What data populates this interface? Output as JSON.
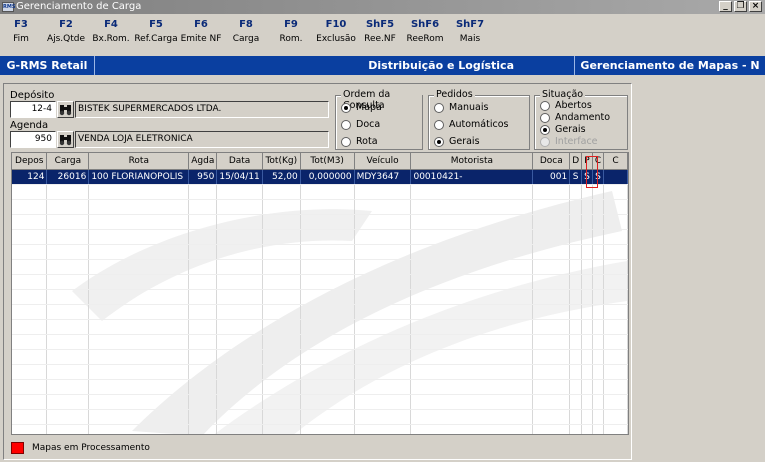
{
  "window": {
    "title": "Gerenciamento de Carga",
    "icon_text": "RMS",
    "buttons": [
      "_",
      "❐",
      "×"
    ]
  },
  "function_keys": [
    {
      "key": "F3",
      "label": "Fim"
    },
    {
      "key": "F2",
      "label": "Ajs.Qtde"
    },
    {
      "key": "F4",
      "label": "Bx.Rom."
    },
    {
      "key": "F5",
      "label": "Ref.Carga"
    },
    {
      "key": "F6",
      "label": "Emite NF"
    },
    {
      "key": "F8",
      "label": "Carga"
    },
    {
      "key": "F9",
      "label": "Rom."
    },
    {
      "key": "F10",
      "label": "Exclusão"
    },
    {
      "key": "ShF5",
      "label": "Ree.NF"
    },
    {
      "key": "ShF6",
      "label": "ReeRom"
    },
    {
      "key": "ShF7",
      "label": "Mais"
    }
  ],
  "banner": {
    "left": "G-RMS Retail",
    "center": "Distribuição e Logística",
    "right": "Gerenciamento de Mapas - N"
  },
  "deposito": {
    "label": "Depósito",
    "code": "12-4",
    "description": "BISTEK SUPERMERCADOS LTDA."
  },
  "agenda": {
    "label": "Agenda",
    "code": "950",
    "description": "VENDA LOJA ELETRONICA"
  },
  "ordem_consulta": {
    "title": "Ordem da Consulta",
    "options": [
      "Mapa",
      "Doca",
      "Rota"
    ],
    "selected": "Mapa"
  },
  "pedidos": {
    "title": "Pedidos",
    "options": [
      "Manuais",
      "Automáticos",
      "Gerais"
    ],
    "selected": "Gerais"
  },
  "situacao": {
    "title": "Situação",
    "options": [
      "Abertos",
      "Andamento",
      "Gerais",
      "Interface"
    ],
    "selected": "Gerais",
    "disabled": [
      "Interface"
    ]
  },
  "grid": {
    "columns": [
      "Depos",
      "Carga",
      "Rota",
      "Agda",
      "Data",
      "Tot(Kg)",
      "Tot(M3)",
      "Veículo",
      "Motorista",
      "Doca",
      "D",
      "P",
      "C",
      "C"
    ],
    "rows": [
      [
        "124",
        "26016",
        "100  FLORIANOPOLIS",
        "950",
        "15/04/11",
        "52,00",
        "0,000000",
        "MDY3647",
        "00010421-",
        "001",
        "S",
        "S",
        "S",
        ""
      ]
    ]
  },
  "legend": {
    "color": "#ff0000",
    "label": "Mapas em Processamento"
  },
  "colors": {
    "banner": "#0a3fa0",
    "selection": "#0a246a",
    "fkey": "#0a2a78",
    "highlight_box": "#e02020"
  }
}
